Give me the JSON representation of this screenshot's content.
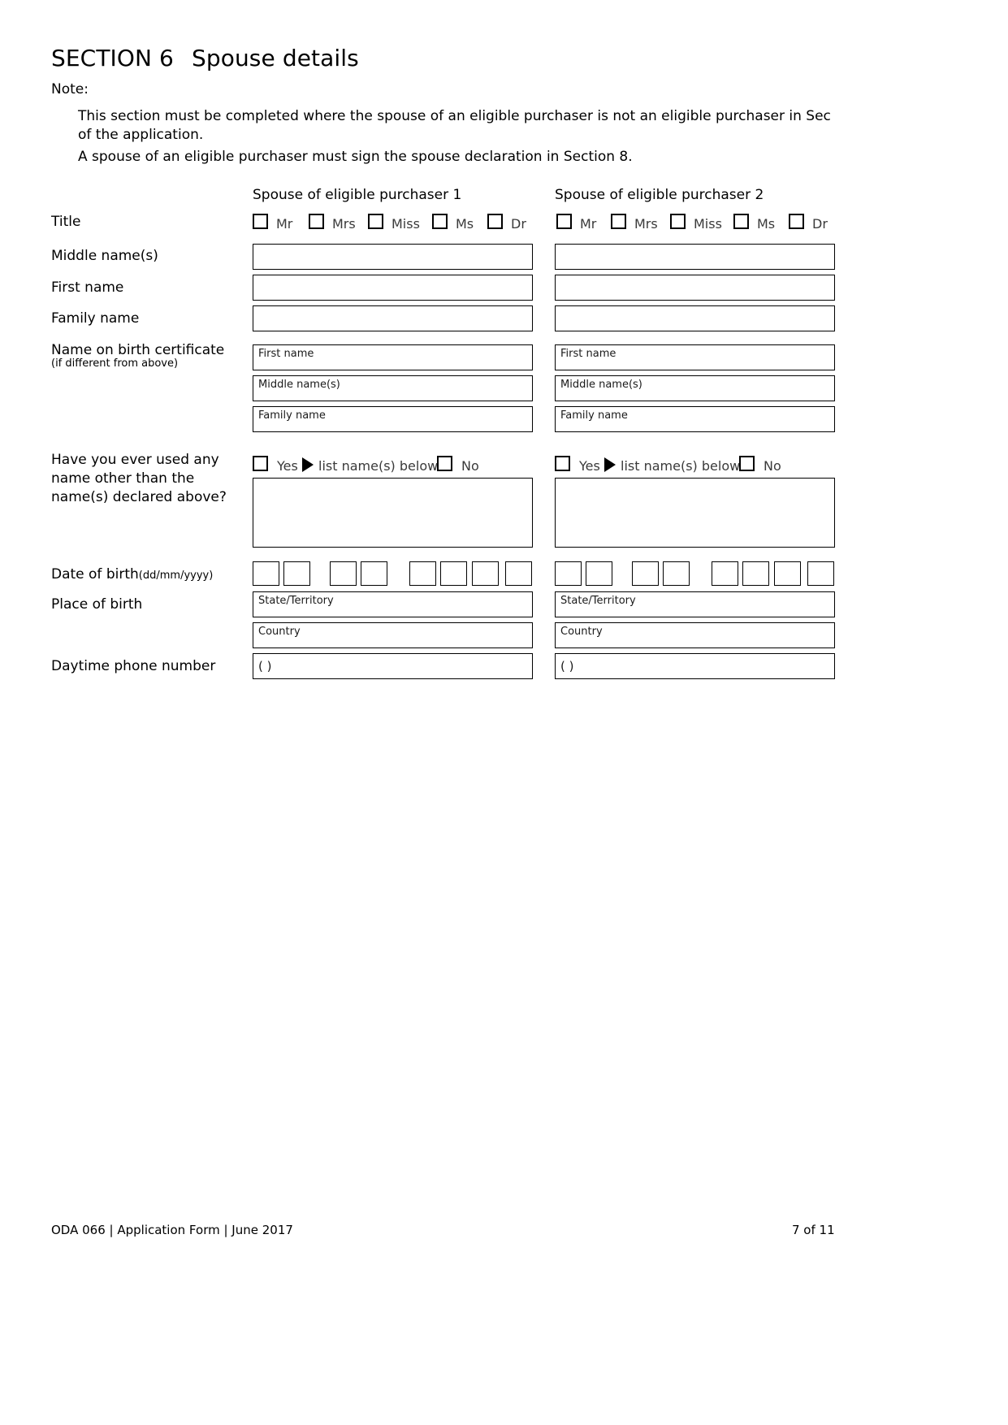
{
  "section": {
    "number": "SECTION 6",
    "title": "Spouse details"
  },
  "note": {
    "label": "Note:",
    "line1": "This section must be completed where the spouse of an eligible purchaser is not an eligible purchaser in Sec",
    "line1_cont": "of the application.",
    "line2": "A spouse of an eligible purchaser must sign the spouse declaration in Section 8."
  },
  "columns": {
    "col1_header": "Spouse of eligible purchaser 1",
    "col2_header": "Spouse of eligible purchaser 2"
  },
  "rows": {
    "title": "Title",
    "middle_name": "Middle name(s)",
    "first_name": "First name",
    "family_name": "Family name",
    "birth_certificate": "Name on birth certificate",
    "birth_certificate_sub": "(if different from above)",
    "other_name_q": "Have you ever used any name other than the name(s) declared above?",
    "date_of_birth": "Date of birth",
    "date_of_birth_hint": "(dd/mm/yyyy)",
    "place_of_birth": "Place of birth",
    "daytime_phone": "Daytime phone number"
  },
  "titles": [
    "Mr",
    "Mrs",
    "Miss",
    "Ms",
    "Dr"
  ],
  "birth_cert_placeholders": [
    "First name",
    "Middle name(s)",
    "Family name"
  ],
  "other_name_options": {
    "yes": "Yes",
    "arrow_text": "list name(s) below",
    "no": "No"
  },
  "place_of_birth_placeholders": [
    "State/Territory",
    "Country"
  ],
  "phone_prefix": "(        )",
  "fields": {
    "sp1_middle_name": "",
    "sp1_first_name": "",
    "sp1_family_name": "",
    "sp1_bc_first": "",
    "sp1_bc_middle": "",
    "sp1_bc_family": "",
    "sp1_other_names": "",
    "sp1_state": "",
    "sp1_country": "",
    "sp1_phone": "",
    "sp2_middle_name": "",
    "sp2_first_name": "",
    "sp2_family_name": "",
    "sp2_bc_first": "",
    "sp2_bc_middle": "",
    "sp2_bc_family": "",
    "sp2_other_names": "",
    "sp2_state": "",
    "sp2_country": "",
    "sp2_phone": ""
  },
  "footer": {
    "left": "ODA 066  |  Application Form  |  June 2017",
    "right": "7 of 11"
  }
}
